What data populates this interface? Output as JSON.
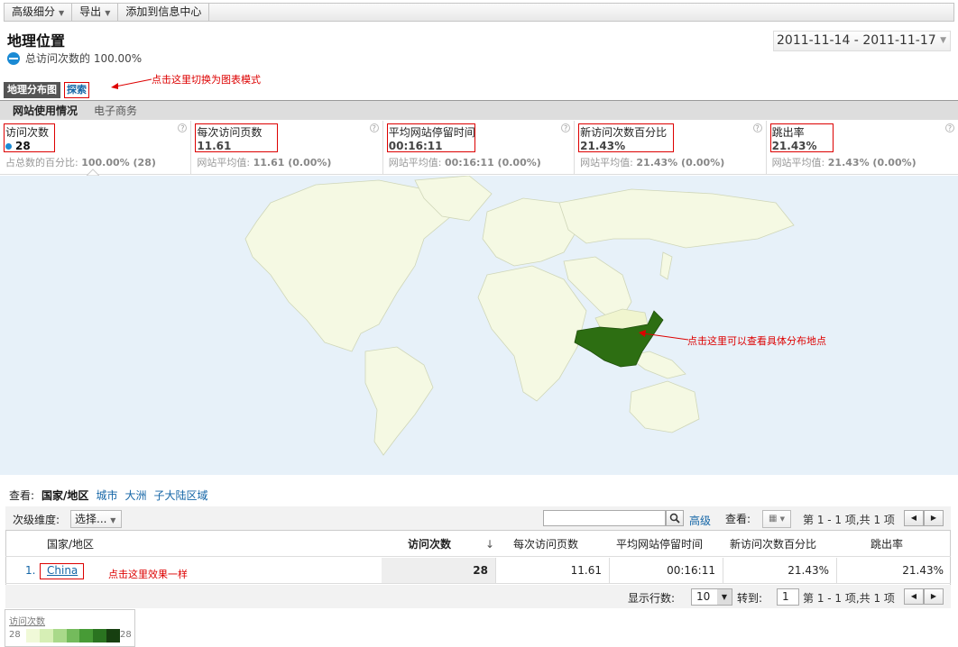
{
  "toolbar": {
    "advanced_segments": "高级细分",
    "export": "导出",
    "add_dashboard": "添加到信息中心"
  },
  "page": {
    "title": "地理位置",
    "segment_label": "总访问次数的 100.00%"
  },
  "date_range": {
    "value": "2011-11-14 - 2011-11-17"
  },
  "view_tabs": {
    "map_overlay": "地理分布图",
    "explorer": "探索"
  },
  "annotations": {
    "switch_chart": "点击这里切换为图表模式",
    "view_locations": "点击这里可以查看具体分布地点",
    "same_effect": "点击这里效果一样"
  },
  "subtabs": {
    "site_usage": "网站使用情况",
    "ecommerce": "电子商务"
  },
  "metrics": [
    {
      "label": "访问次数",
      "value": "28",
      "sub_label": "占总数的百分比:",
      "sub_value": "100.00% (28)"
    },
    {
      "label": "每次访问页数",
      "value": "11.61",
      "sub_label": "网站平均值:",
      "sub_value": "11.61 (0.00%)"
    },
    {
      "label": "平均网站停留时间",
      "value": "00:16:11",
      "sub_label": "网站平均值:",
      "sub_value": "00:16:11 (0.00%)"
    },
    {
      "label": "新访问次数百分比",
      "value": "21.43%",
      "sub_label": "网站平均值:",
      "sub_value": "21.43% (0.00%)"
    },
    {
      "label": "跳出率",
      "value": "21.43%",
      "sub_label": "网站平均值:",
      "sub_value": "21.43% (0.00%)"
    }
  ],
  "map_legend": {
    "title": "访问次数",
    "min": "28",
    "max": "28"
  },
  "colors": {
    "highlight_country": "#2d6e12",
    "land": "#f5f9e3",
    "ocean": "#e7f1f9",
    "annotation": "#dd0000",
    "link": "#1566a7"
  },
  "view_row": {
    "label": "查看:",
    "selected": "国家/地区",
    "links": [
      "城市",
      "大洲",
      "子大陆区域"
    ]
  },
  "table_toolbar": {
    "secondary_dim_label": "次级维度:",
    "secondary_dim_select": "选择...",
    "search_placeholder": "",
    "advanced": "高级",
    "view_label": "查看:",
    "pagination": "第 1 - 1 项,共 1 项"
  },
  "table": {
    "headers": [
      "国家/地区",
      "访问次数",
      "每次访问页数",
      "平均网站停留时间",
      "新访问次数百分比",
      "跳出率"
    ],
    "sort_indicator": "↓",
    "rows": [
      {
        "index": "1.",
        "country": "China",
        "visits": "28",
        "pages_per_visit": "11.61",
        "avg_time": "00:16:11",
        "new_visits": "21.43%",
        "bounce": "21.43%"
      }
    ]
  },
  "table_footer": {
    "rows_label": "显示行数:",
    "rows_value": "10",
    "goto_label": "转到:",
    "goto_value": "1",
    "pagination": "第 1 - 1 项,共 1 项"
  }
}
